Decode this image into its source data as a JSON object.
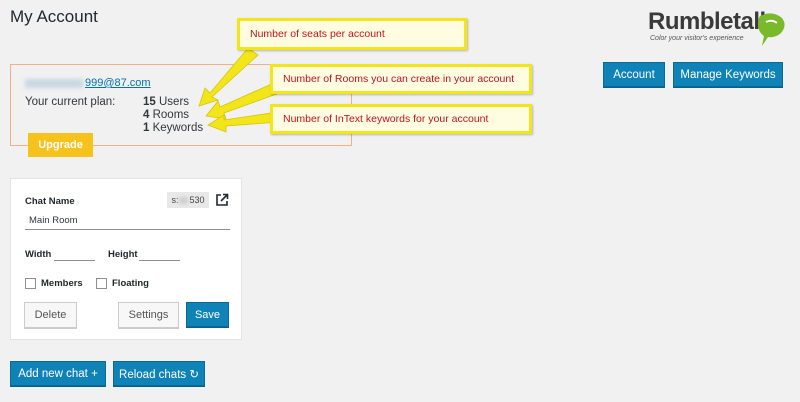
{
  "page": {
    "title": "My Account"
  },
  "logo": {
    "word_a": "Rumble",
    "word_b": "talk",
    "tagline": "Color your visitor's experience"
  },
  "account": {
    "email_visible": "999@87.com",
    "plan_label": "Your current plan:",
    "plan": [
      {
        "count": "15",
        "unit": "Users"
      },
      {
        "count": "4",
        "unit": "Rooms"
      },
      {
        "count": "1",
        "unit": "Keywords"
      }
    ],
    "upgrade_label": "Upgrade"
  },
  "callouts": {
    "seats": "Number of seats per account",
    "rooms": "Number of Rooms you can create in your account",
    "keywords": "Number of InText keywords for your account"
  },
  "topbar": {
    "account_label": "Account",
    "keywords_label": "Manage Keywords"
  },
  "chat": {
    "name_label": "Chat Name",
    "id_prefix": "s:",
    "id_suffix": "530",
    "name_value": "Main Room",
    "width_label": "Width",
    "height_label": "Height",
    "members_label": "Members",
    "floating_label": "Floating",
    "delete_label": "Delete",
    "settings_label": "Settings",
    "save_label": "Save"
  },
  "footer": {
    "add_label": "Add new chat +",
    "reload_label": "Reload chats ↻"
  },
  "colors": {
    "primary": "#0f83b8",
    "upgrade": "#f7c21c",
    "callout_text": "#c1121f",
    "callout_border": "#f2e51a"
  }
}
